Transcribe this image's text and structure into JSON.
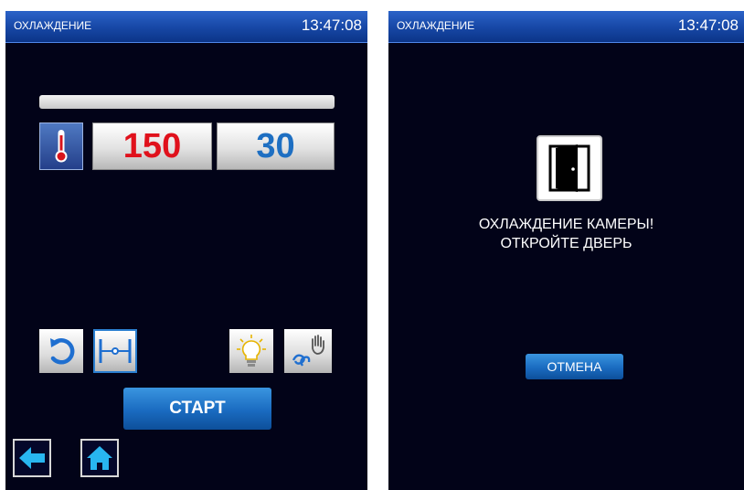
{
  "left": {
    "header": {
      "title": "ОХЛАЖДЕНИЕ",
      "time": "13:47:08"
    },
    "progress": {
      "fraction": 0
    },
    "temperature": {
      "value": "150",
      "icon": "thermometer-icon"
    },
    "timer": {
      "value": "30"
    },
    "toolbar": {
      "reset_icon": "reset-arrow-icon",
      "level_icon": "level-icon",
      "light_icon": "light-bulb-icon",
      "manual_icon": "manual-hand-icon"
    },
    "start_label": "СТАРТ",
    "nav": {
      "back_icon": "arrow-left-icon",
      "home_icon": "home-icon"
    }
  },
  "right": {
    "header": {
      "title": "ОХЛАЖДЕНИЕ",
      "time": "13:47:08"
    },
    "door_icon": "open-door-icon",
    "message_line1": "ОХЛАЖДЕНИЕ КАМЕРЫ!",
    "message_line2": "ОТКРОЙТЕ ДВЕРЬ",
    "cancel_label": "ОТМЕНА"
  },
  "colors": {
    "screen_bg": "#020318",
    "header_bg": "#1849a8",
    "temp_value": "#e0111c",
    "timer_value": "#1e6fc2",
    "button_blue": "#1a6bc0"
  }
}
